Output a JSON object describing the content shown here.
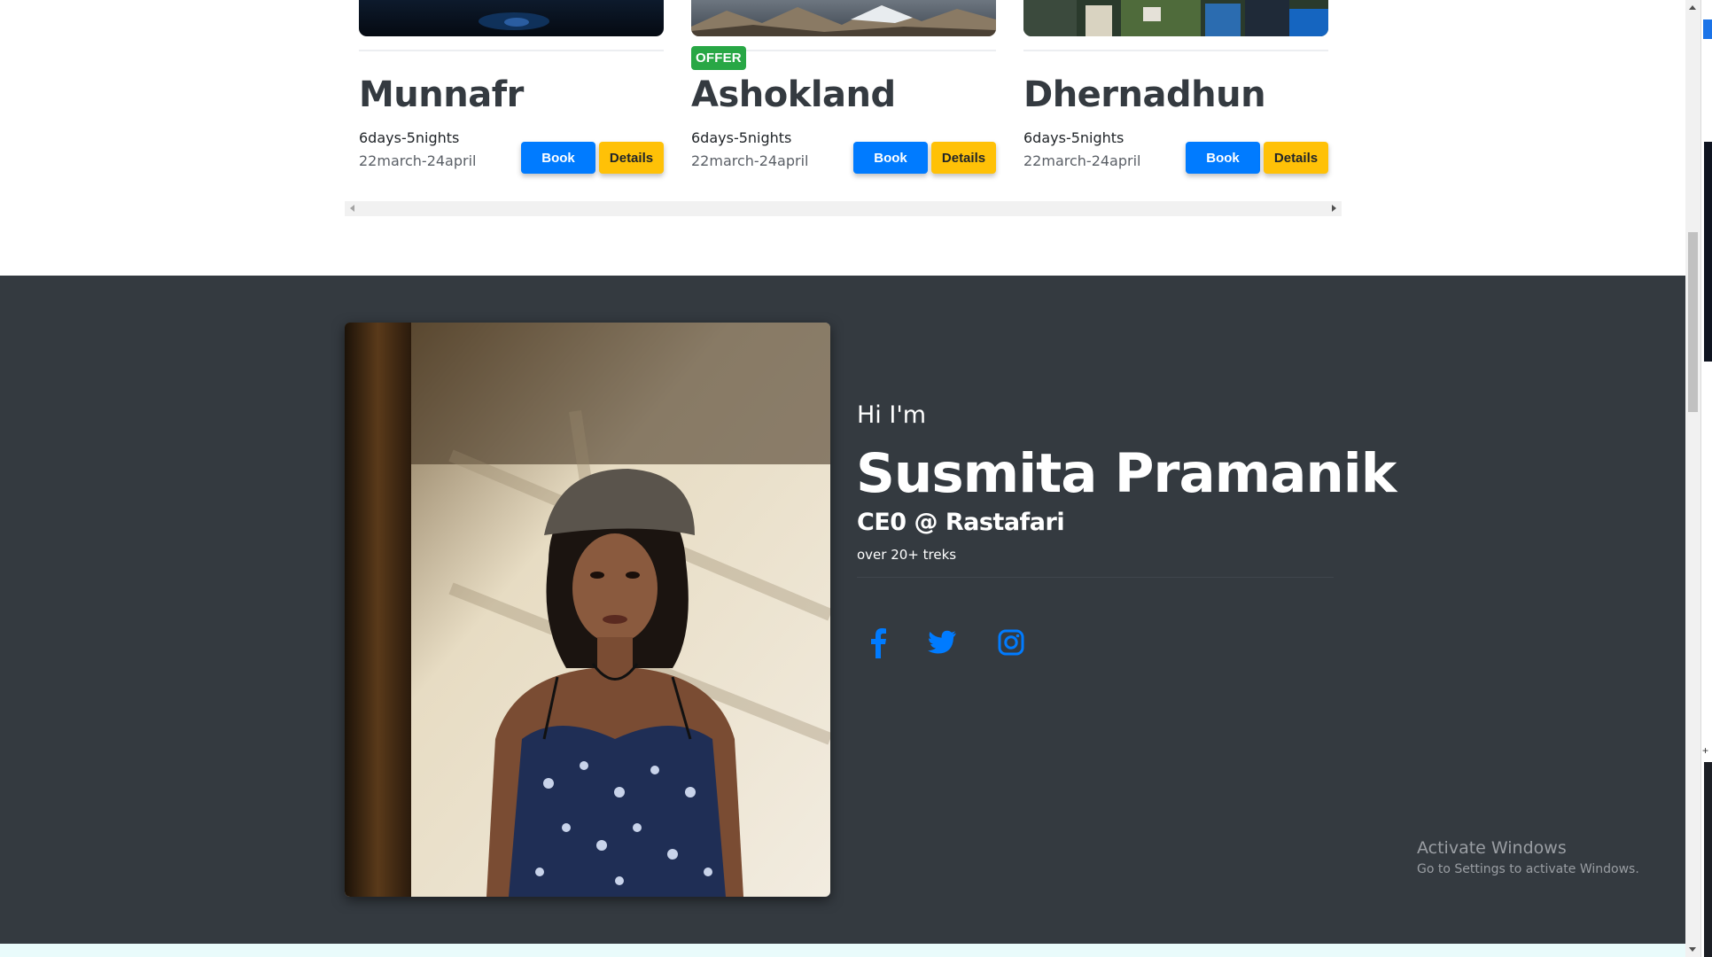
{
  "tours": {
    "cards": [
      {
        "title": "Munnafr",
        "duration": "6days-5nights",
        "dates": "22march-24april",
        "book_label": "Book",
        "details_label": "Details",
        "badge": ""
      },
      {
        "title": "Ashokland",
        "duration": "6days-5nights",
        "dates": "22march-24april",
        "book_label": "Book",
        "details_label": "Details",
        "badge": "OFFER"
      },
      {
        "title": "Dhernadhun",
        "duration": "6days-5nights",
        "dates": "22march-24april",
        "book_label": "Book",
        "details_label": "Details",
        "badge": ""
      }
    ]
  },
  "profile": {
    "greeting": "Hi I'm",
    "name": "Susmita Pramanik",
    "role": "CE0 @ Rastafari",
    "treks": "over 20+ treks",
    "social": [
      "facebook-icon",
      "twitter-icon",
      "instagram-icon"
    ]
  },
  "watermark": {
    "line1": "Activate Windows",
    "line2": "Go to Settings to activate Windows."
  },
  "colors": {
    "primary": "#007bff",
    "warning": "#ffc107",
    "success": "#28a745",
    "dark": "#343a40"
  }
}
